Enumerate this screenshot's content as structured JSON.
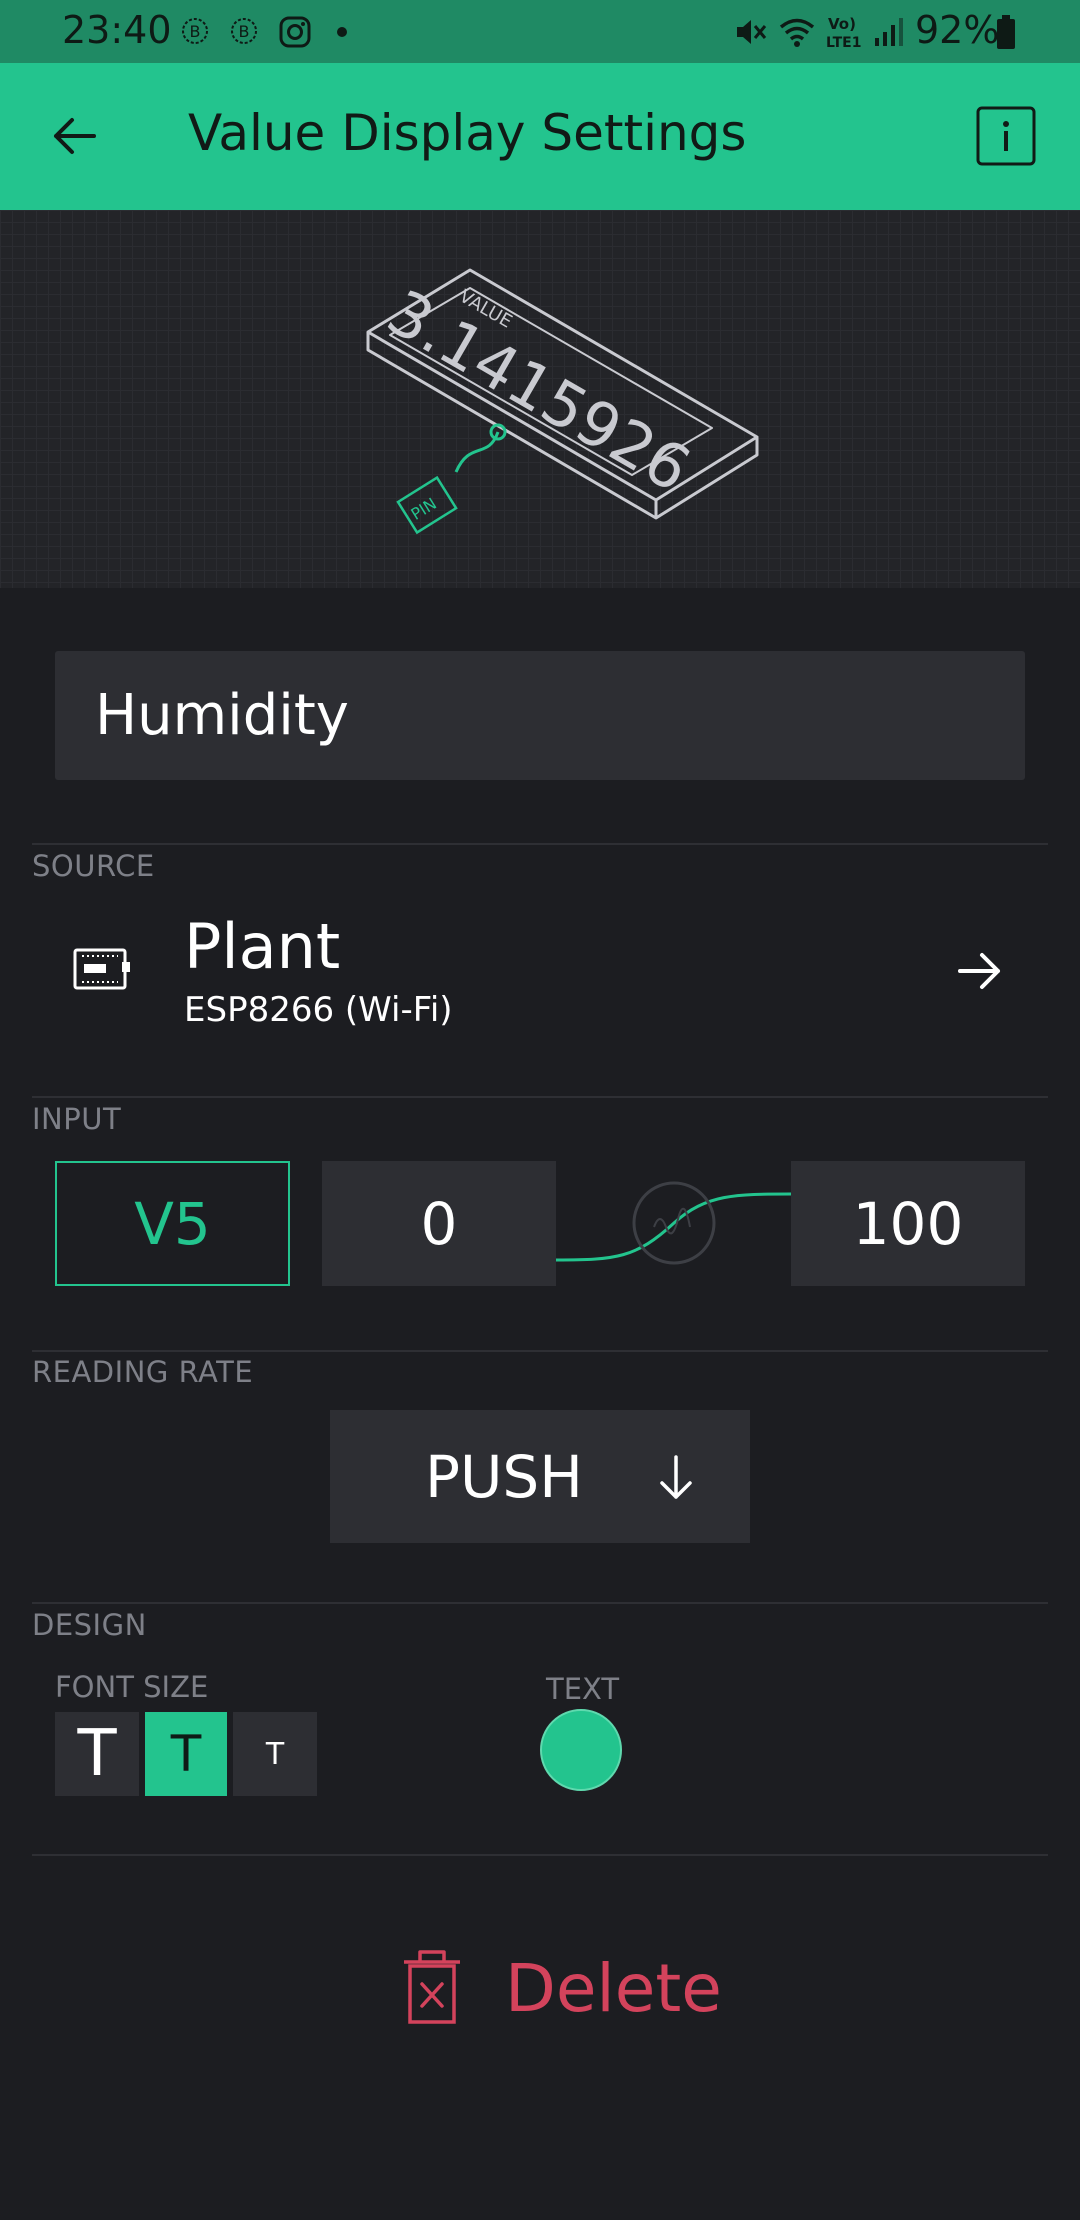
{
  "status_bar": {
    "time": "23:40",
    "battery": "92%",
    "icons": [
      "b-notification-icon",
      "b-notification-icon",
      "instagram-icon",
      "dot-icon",
      "mute-icon",
      "wifi-icon",
      "volte-icon",
      "signal-icon",
      "battery-icon"
    ],
    "network_label": "Vo) LTE1"
  },
  "app_bar": {
    "title": "Value Display Settings",
    "back_icon": "back-arrow-icon",
    "info_icon": "info-icon"
  },
  "illustration": {
    "caption": "VALUE",
    "display_value": "3.1415926",
    "pin_label": "PIN"
  },
  "name_field": {
    "value": "Humidity"
  },
  "source": {
    "label": "SOURCE",
    "device_name": "Plant",
    "board": "ESP8266 (Wi-Fi)",
    "icon": "device-board-icon",
    "arrow_icon": "arrow-right-icon"
  },
  "input": {
    "label": "INPUT",
    "pin": "V5",
    "min": "0",
    "max": "100",
    "mapping_icon": "curve-mapping-icon"
  },
  "reading_rate": {
    "label": "READING RATE",
    "value": "PUSH",
    "dropdown_icon": "arrow-down-icon"
  },
  "design": {
    "label": "DESIGN",
    "font_size_label": "FONT SIZE",
    "font_glyph": "T",
    "selected_font_size": "medium",
    "text_label": "TEXT",
    "text_color": "#23c48e"
  },
  "delete": {
    "label": "Delete",
    "icon": "trash-icon",
    "color": "#d3435c"
  },
  "colors": {
    "accent": "#23c48e",
    "background": "#1c1d21",
    "field": "#2d2e33",
    "danger": "#d3435c"
  }
}
